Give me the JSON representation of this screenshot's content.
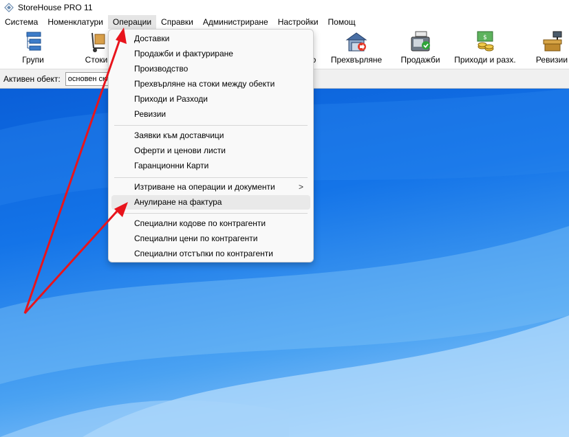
{
  "window": {
    "title": "StoreHouse PRO 11"
  },
  "menubar": {
    "items": [
      {
        "label": "Система"
      },
      {
        "label": "Номенклатури"
      },
      {
        "label": "Операции"
      },
      {
        "label": "Справки"
      },
      {
        "label": "Администриране"
      },
      {
        "label": "Настройки"
      },
      {
        "label": "Помощ"
      }
    ]
  },
  "toolbar": {
    "groups_label": "Групи",
    "stock_label": "Стоки",
    "hidden_label": "о",
    "transfer_label": "Прехвърляне",
    "sales_label": "Продажби",
    "income_label": "Приходи и разх.",
    "revisions_label": "Ревизии"
  },
  "objbar": {
    "label": "Активен обект:",
    "value": "основен склад"
  },
  "dropdown": {
    "items": [
      {
        "label": "Доставки"
      },
      {
        "label": "Продажби и фактуриране"
      },
      {
        "label": "Производство"
      },
      {
        "label": "Прехвърляне на стоки между обекти"
      },
      {
        "label": "Приходи и Разходи"
      },
      {
        "label": "Ревизии"
      },
      {
        "label": "Заявки към доставчици"
      },
      {
        "label": "Оферти и ценови листи"
      },
      {
        "label": "Гаранционни Карти"
      },
      {
        "label": "Изтриване на операции и документи",
        "submenu_glyph": ">"
      },
      {
        "label": "Анулиране на фактура"
      },
      {
        "label": "Специални кодове по контрагенти"
      },
      {
        "label": "Специални цени по контрагенти"
      },
      {
        "label": "Специални отстъпки по контрагенти"
      }
    ]
  },
  "colors": {
    "annotation_arrow": "#e8141c",
    "desktop_top": "#0a5fd8",
    "desktop_bottom": "#a7d3fb"
  }
}
